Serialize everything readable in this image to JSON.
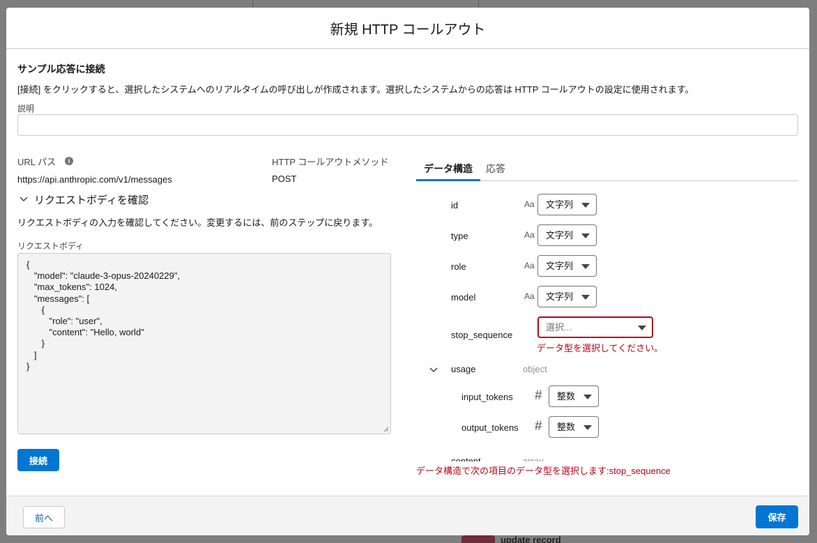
{
  "background": {
    "record_label": "update record"
  },
  "modal": {
    "title": "新規 HTTP コールアウト"
  },
  "connect_section": {
    "heading": "サンプル応答に接続",
    "description": "[接続] をクリックすると、選択したシステムへのリアルタイムの呼び出しが作成されます。選択したシステムからの応答は HTTP コールアウトの設定に使用されます。",
    "description_label": "説明",
    "description_value": ""
  },
  "request": {
    "url_label": "URL パス",
    "url_value": "https://api.anthropic.com/v1/messages",
    "method_label": "HTTP コールアウトメソッド",
    "method_value": "POST",
    "review_toggle": "リクエストボディを確認",
    "review_hint": "リクエストボディの入力を確認してください。変更するには、前のステップに戻ります。",
    "body_label": "リクエストボディ",
    "body_text": "{\n   \"model\": \"claude-3-opus-20240229\",\n   \"max_tokens\": 1024,\n   \"messages\": [\n      {\n         \"role\": \"user\",\n         \"content\": \"Hello, world\"\n      }\n   ]\n}",
    "connect_button": "接続"
  },
  "tabs": [
    {
      "label": "データ構造",
      "active": true
    },
    {
      "label": "応答",
      "active": false
    }
  ],
  "structure": {
    "type_text_icon": "Aa",
    "type_number_icon": "#",
    "fields": [
      {
        "name": "id",
        "type": "文字列",
        "icon": "text-type-icon"
      },
      {
        "name": "type",
        "type": "文字列",
        "icon": "text-type-icon"
      },
      {
        "name": "role",
        "type": "文字列",
        "icon": "text-type-icon"
      },
      {
        "name": "model",
        "type": "文字列",
        "icon": "text-type-icon"
      },
      {
        "name": "stop_sequence",
        "placeholder": "選択...",
        "error": "データ型を選択してください。"
      }
    ],
    "usage": {
      "name": "usage",
      "kind": "object",
      "children": [
        {
          "name": "input_tokens",
          "type": "整数",
          "icon": "number-type-icon"
        },
        {
          "name": "output_tokens",
          "type": "整数",
          "icon": "number-type-icon"
        }
      ]
    },
    "clipped_row": {
      "name": "content",
      "kind": "array"
    },
    "footer_error": "データ構造で次の項目のデータ型を選択します:stop_sequence"
  },
  "footer": {
    "back_button": "前へ",
    "save_button": "保存"
  },
  "colors": {
    "brand": "#0176d3",
    "error": "#ba0517"
  }
}
